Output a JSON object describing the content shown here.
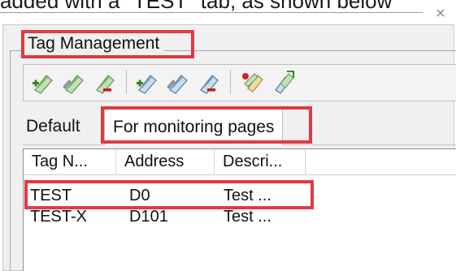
{
  "caption": "added with a \"TEST\" tab, as shown below",
  "window": {
    "close_glyph": "×"
  },
  "group_title": "Tag Management",
  "toolbar": {
    "buttons": [
      {
        "icon": "add-tag-icon"
      },
      {
        "icon": "edit-tag-icon"
      },
      {
        "icon": "delete-tag-icon"
      },
      {
        "icon": "add-tag-icon"
      },
      {
        "icon": "edit-tag-icon"
      },
      {
        "icon": "delete-tag-icon"
      },
      {
        "icon": "import-tags-icon"
      },
      {
        "icon": "export-tags-icon"
      }
    ]
  },
  "tabs": [
    {
      "label": "Default",
      "active": false
    },
    {
      "label": "For monitoring pages",
      "active": true
    }
  ],
  "table": {
    "columns": [
      "Tag N...",
      "Address",
      "Descri..."
    ],
    "rows": [
      [
        "TEST",
        "D0",
        "Test ..."
      ],
      [
        "TEST-X",
        "D101",
        "Test ..."
      ]
    ]
  },
  "colors": {
    "highlight": "#e03a41",
    "panel_bg": "#f0f0f0"
  }
}
